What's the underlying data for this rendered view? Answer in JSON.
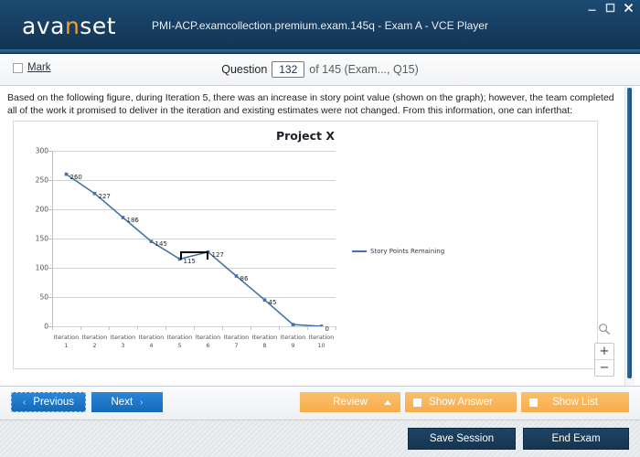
{
  "window": {
    "logo_text_1": "ava",
    "logo_accent": "n",
    "logo_text_2": "set",
    "title": "PMI-ACP.examcollection.premium.exam.145q - Exam A - VCE Player",
    "minimize_label": "minimize",
    "maximize_label": "maximize",
    "close_label": "close"
  },
  "questionbar": {
    "mark_label": "Mark",
    "question_word": "Question",
    "question_number": "132",
    "of_total": "of 145 (Exam..., Q15)"
  },
  "question": {
    "text": "Based on the following figure, during Iteration 5, there was an increase in story point value (shown on the graph); however, the team completed all of the work it promised to deliver in the iteration and existing estimates were not changed. From this information, one can inferthat:"
  },
  "zoom_widget": {
    "magnifier_icon": "search-icon",
    "zoom_in_label": "+",
    "zoom_out_label": "−"
  },
  "actions": {
    "previous_label": "Previous",
    "previous_chev": "‹",
    "next_label": "Next",
    "next_chev": "›",
    "review_label": "Review",
    "show_answer_label": "Show Answer",
    "show_list_label": "Show List"
  },
  "footer": {
    "save_session_label": "Save Session",
    "end_exam_label": "End Exam"
  },
  "colors": {
    "header_navy": "#173f63",
    "accent_orange": "#f0a030",
    "button_blue": "#1669b8",
    "button_orange": "#f7ad4a",
    "footer_navy": "#16354f",
    "series_blue": "#4472a8"
  },
  "chart_data": {
    "type": "line",
    "title": "Project X",
    "xlabel": "",
    "ylabel": "",
    "categories": [
      "Iteration 1",
      "Iteration 2",
      "Iteration 3",
      "Iteration 4",
      "Iteration 5",
      "Iteration 6",
      "Iteration 7",
      "Iteration 8",
      "Iteration 9",
      "Iteration 10"
    ],
    "category_lines": [
      [
        "Iteration",
        "1"
      ],
      [
        "Iteration",
        "2"
      ],
      [
        "Iteration",
        "3"
      ],
      [
        "Iteration",
        "4"
      ],
      [
        "Iteration",
        "5"
      ],
      [
        "Iteration",
        "6"
      ],
      [
        "Iteration",
        "7"
      ],
      [
        "Iteration",
        "8"
      ],
      [
        "Iteration",
        "9"
      ],
      [
        "Iteration",
        "10"
      ]
    ],
    "series": [
      {
        "name": "Story Points Remaining",
        "color": "#4472a8",
        "values": [
          260,
          227,
          186,
          145,
          115,
          127,
          86,
          45,
          3,
          0
        ],
        "data_labels": [
          "260",
          "227",
          "186",
          "145",
          "115",
          "127",
          "86",
          "45",
          "",
          "0"
        ]
      }
    ],
    "ylim": [
      0,
      300
    ],
    "yticks": [
      0,
      50,
      100,
      150,
      200,
      250,
      300
    ],
    "ytick_labels": [
      "0",
      "50",
      "100",
      "150",
      "200",
      "250",
      "300"
    ],
    "grid": true,
    "legend_position": "right",
    "annotation": {
      "type": "bracket",
      "color": "#000000",
      "from_category": "Iteration 5",
      "to_category": "Iteration 6",
      "note": "highlights increase from 115 to 127"
    }
  }
}
